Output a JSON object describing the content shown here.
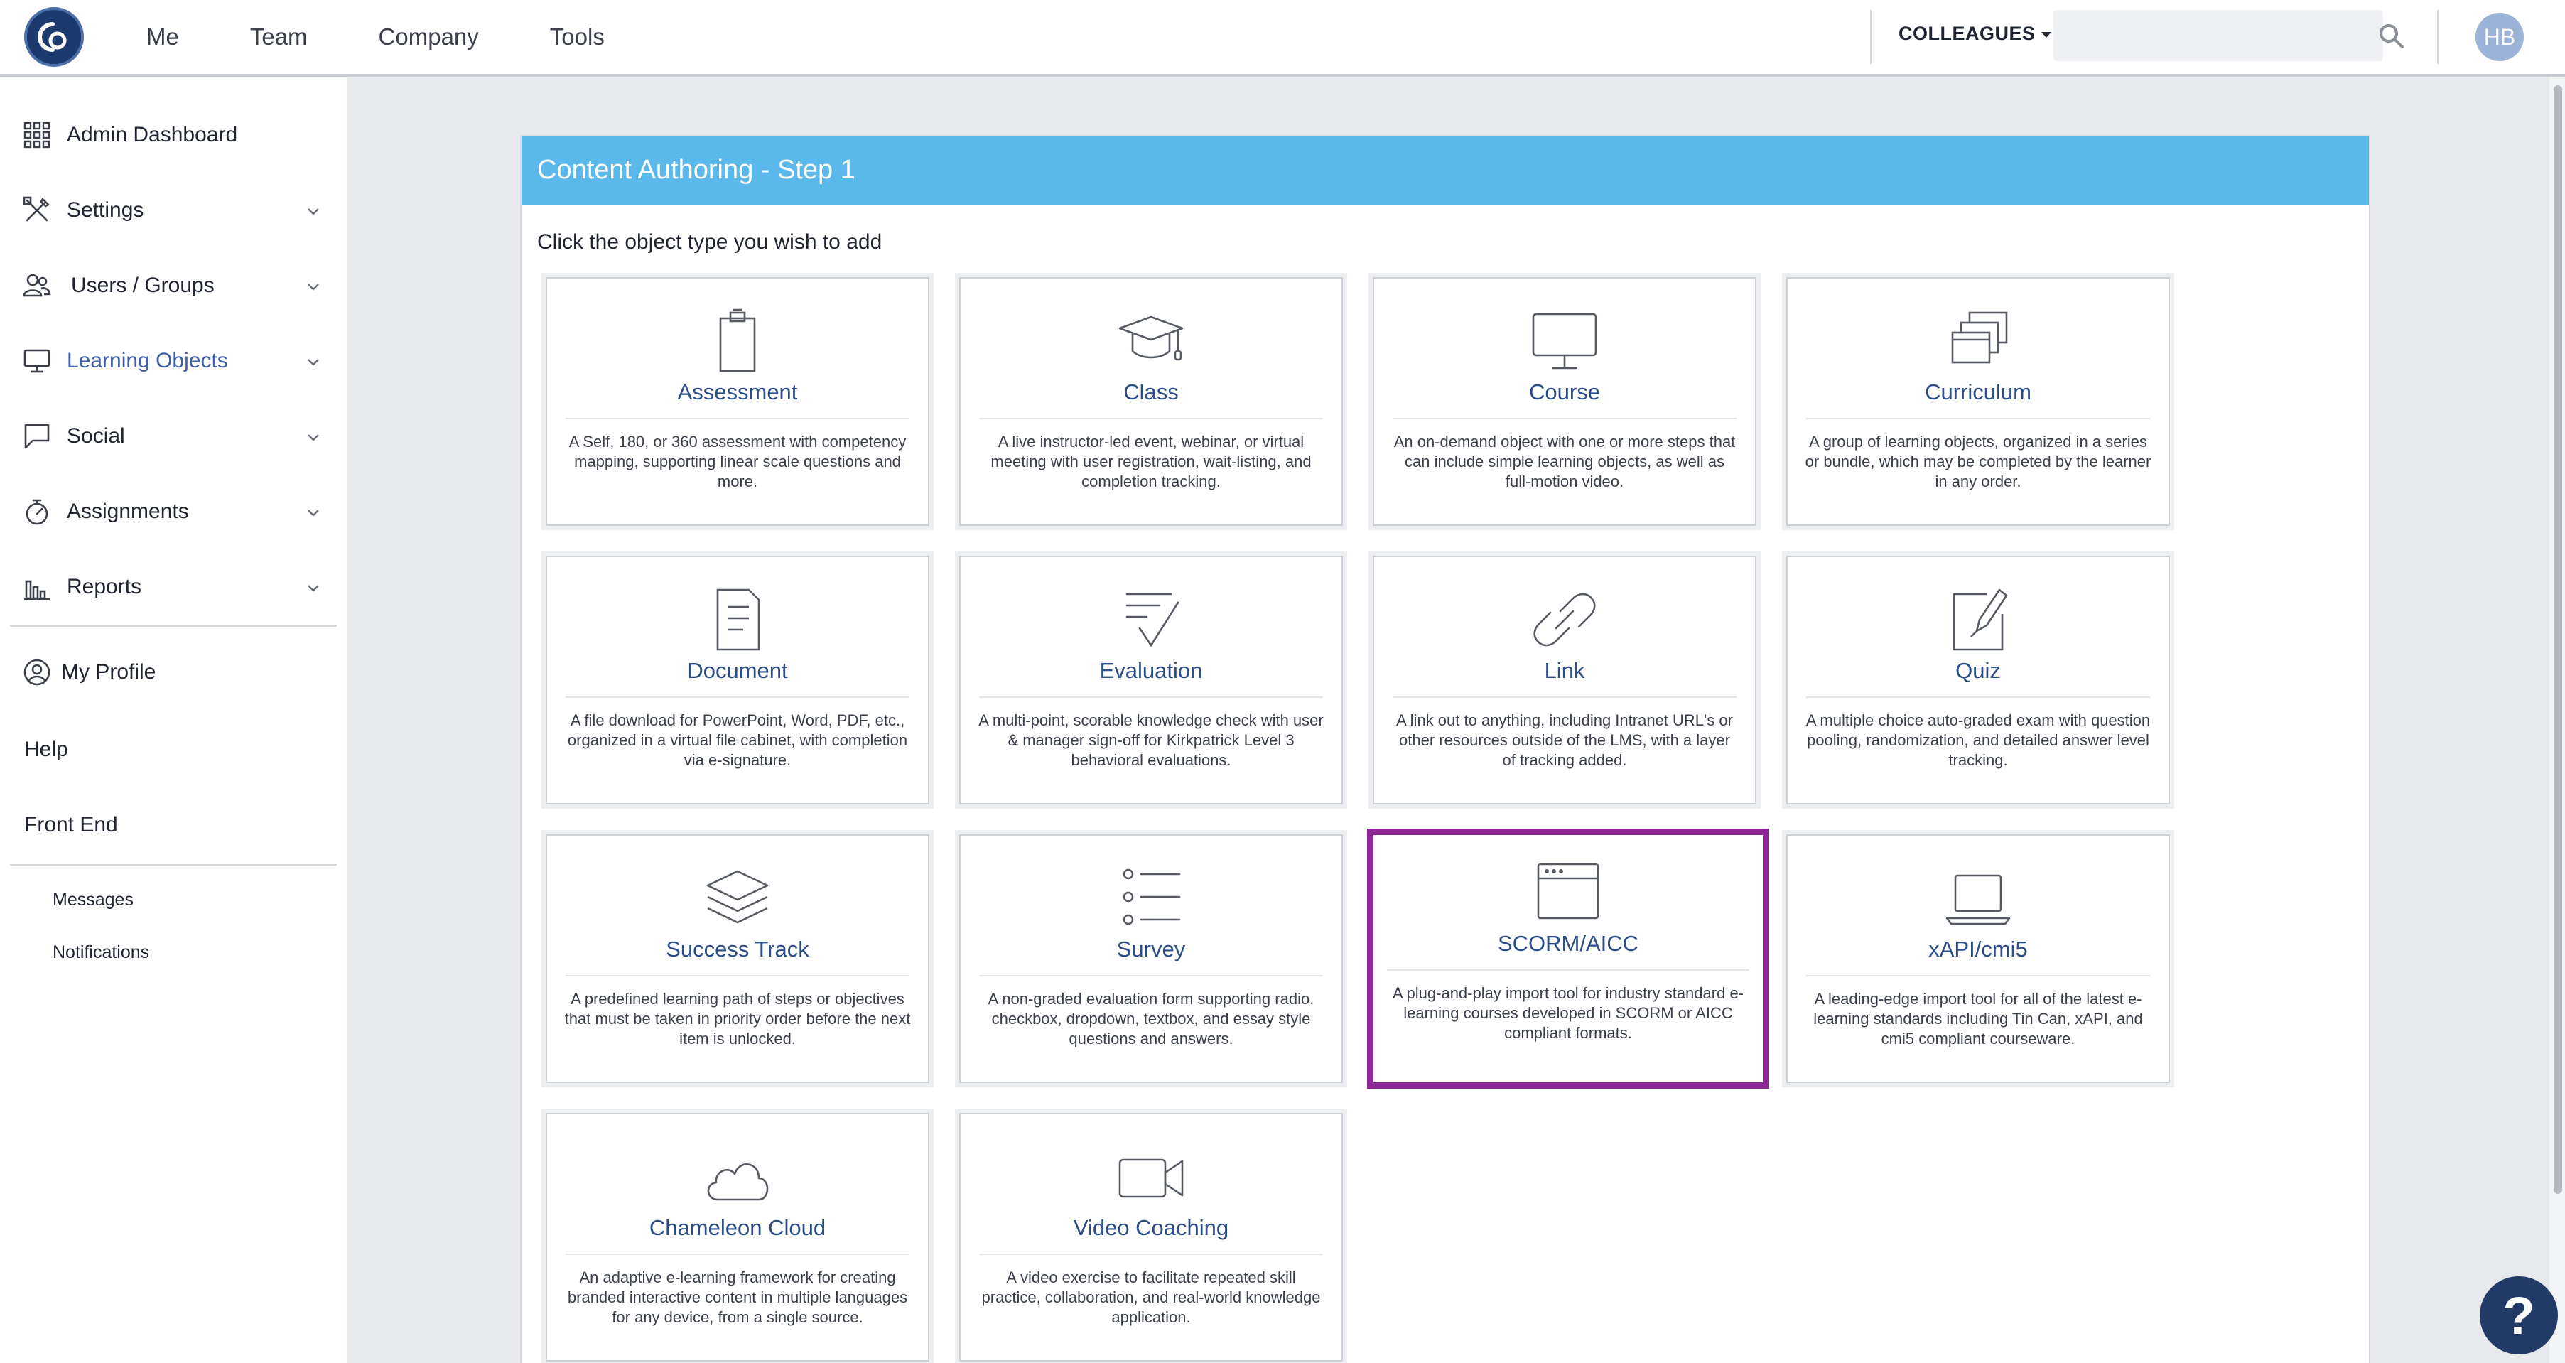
{
  "topnav": {
    "items": [
      "Me",
      "Team",
      "Company",
      "Tools"
    ],
    "colleagues_label": "COLLEAGUES",
    "search_placeholder": "",
    "avatar_initials": "HB"
  },
  "sidebar": {
    "items": [
      {
        "label": "Admin Dashboard",
        "icon": "grid-icon",
        "has_chevron": false
      },
      {
        "label": "Settings",
        "icon": "tools-icon",
        "has_chevron": true
      },
      {
        "label": "Users / Groups",
        "icon": "users-icon",
        "has_chevron": true
      },
      {
        "label": "Learning Objects",
        "icon": "monitor-icon",
        "has_chevron": true,
        "active": true
      },
      {
        "label": "Social",
        "icon": "chat-icon",
        "has_chevron": true
      },
      {
        "label": "Assignments",
        "icon": "stopwatch-icon",
        "has_chevron": true
      },
      {
        "label": "Reports",
        "icon": "bar-chart-icon",
        "has_chevron": true
      }
    ],
    "my_profile": "My Profile",
    "help": "Help",
    "front_end": "Front End",
    "messages": "Messages",
    "notifications": "Notifications"
  },
  "panel": {
    "title": "Content Authoring - Step 1",
    "instruction": "Click the object type you wish to add"
  },
  "tiles": [
    {
      "name": "Assessment",
      "icon": "clipboard-icon",
      "desc": "A Self, 180, or 360 assessment with competency mapping, supporting linear scale questions and more."
    },
    {
      "name": "Class",
      "icon": "graduation-cap-icon",
      "desc": "A live instructor-led event, webinar, or virtual meeting with user registration, wait-listing, and completion tracking."
    },
    {
      "name": "Course",
      "icon": "monitor-icon",
      "desc": "An on-demand object with one or more steps that can include simple learning objects, as well as full-motion video."
    },
    {
      "name": "Curriculum",
      "icon": "stacked-windows-icon",
      "desc": "A group of learning objects, organized in a series or bundle, which may be completed by the learner in any order."
    },
    {
      "name": "Document",
      "icon": "document-icon",
      "desc": "A file download for PowerPoint, Word, PDF, etc., organized in a virtual file cabinet, with completion via e-signature."
    },
    {
      "name": "Evaluation",
      "icon": "checklist-icon",
      "desc": "A multi-point, scorable knowledge check with user & manager sign-off for Kirkpatrick Level 3 behavioral evaluations."
    },
    {
      "name": "Link",
      "icon": "link-icon",
      "desc": "A link out to anything, including Intranet URL's or other resources outside of the LMS, with a layer of tracking added."
    },
    {
      "name": "Quiz",
      "icon": "pencil-paper-icon",
      "desc": "A multiple choice auto-graded exam with question pooling, randomization, and detailed answer level tracking."
    },
    {
      "name": "Success Track",
      "icon": "layers-icon",
      "desc": "A predefined learning path of steps or objectives that must be taken in priority order before the next item is unlocked."
    },
    {
      "name": "Survey",
      "icon": "list-icon",
      "desc": "A non-graded evaluation form supporting radio, checkbox, dropdown, textbox, and essay style questions and answers."
    },
    {
      "name": "SCORM/AICC",
      "icon": "browser-window-icon",
      "desc": "A plug-and-play import tool for industry standard e-learning courses developed in SCORM or AICC compliant formats.",
      "selected": true
    },
    {
      "name": "xAPI/cmi5",
      "icon": "laptop-icon",
      "desc": "A leading-edge import tool for all of the latest e-learning standards including Tin Can, xAPI, and cmi5 compliant courseware."
    },
    {
      "name": "Chameleon Cloud",
      "icon": "cloud-icon",
      "desc": "An adaptive e-learning framework for creating branded interactive content in multiple languages for any device, from a single source."
    },
    {
      "name": "Video Coaching",
      "icon": "video-camera-icon",
      "desc": "A video exercise to facilitate repeated skill practice, collaboration, and real-world knowledge application."
    }
  ],
  "help_fab": "?",
  "colors": {
    "header_blue": "#5ab8ea",
    "tile_title": "#2b4d86",
    "selected_border": "#8f2696",
    "active_nav": "#3c5fa8"
  }
}
